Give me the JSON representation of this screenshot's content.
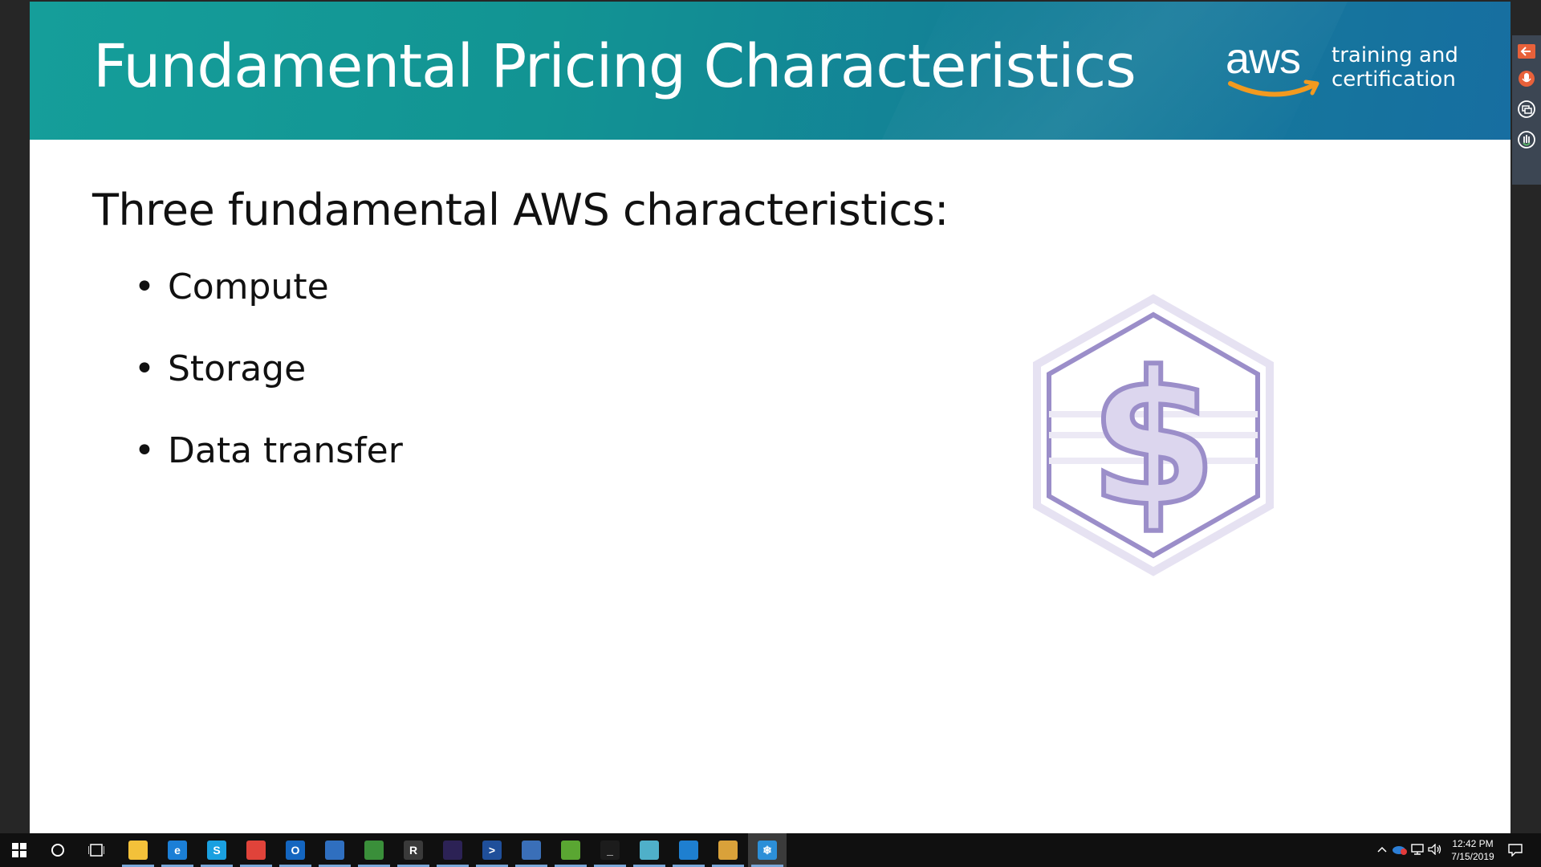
{
  "slide": {
    "title": "Fundamental Pricing Characteristics",
    "logo": {
      "wordmark": "aws",
      "tagline_line1": "training and",
      "tagline_line2": "certification"
    },
    "subtitle": "Three fundamental AWS characteristics:",
    "bullets": [
      {
        "bullet": "•",
        "text": "Compute"
      },
      {
        "bullet": "•",
        "text": "Storage"
      },
      {
        "bullet": "•",
        "text": "Data transfer"
      }
    ],
    "graphic": {
      "icon": "hexagon-dollar-icon",
      "color": "#9b8ec9"
    }
  },
  "side_toolbar": {
    "buttons": [
      {
        "name": "back-arrow-icon",
        "color": "#e8613a"
      },
      {
        "name": "microphone-icon",
        "color": "#e8613a"
      },
      {
        "name": "screen-share-icon",
        "color": "#ffffff"
      },
      {
        "name": "raise-hand-icon",
        "color": "#ffffff"
      }
    ]
  },
  "taskbar": {
    "start_icon": "windows-start-icon",
    "search_icon": "cortana-circle-icon",
    "taskview_icon": "task-view-icon",
    "apps": [
      {
        "name": "file-explorer-icon",
        "glyph": "",
        "color": "#f3c13a"
      },
      {
        "name": "edge-icon",
        "glyph": "e",
        "color": "#1b7fd6"
      },
      {
        "name": "skype-business-icon",
        "glyph": "S",
        "color": "#1aa0e0"
      },
      {
        "name": "chrome-icon",
        "glyph": "",
        "color": "#e0433a"
      },
      {
        "name": "outlook-icon",
        "glyph": "O",
        "color": "#1466c0"
      },
      {
        "name": "network-icon",
        "glyph": "",
        "color": "#2f6fc0"
      },
      {
        "name": "security-icon",
        "glyph": "",
        "color": "#3a8f3a"
      },
      {
        "name": "r-console-icon",
        "glyph": "R",
        "color": "#3a3a3a"
      },
      {
        "name": "eclipse-icon",
        "glyph": "",
        "color": "#2c2255"
      },
      {
        "name": "powershell-icon",
        "glyph": ">",
        "color": "#1f4f9a"
      },
      {
        "name": "remote-desktop-icon",
        "glyph": "",
        "color": "#3a6fb8"
      },
      {
        "name": "notepad-icon",
        "glyph": "",
        "color": "#5aa632"
      },
      {
        "name": "terminal-icon",
        "glyph": "_",
        "color": "#1c1c1c"
      },
      {
        "name": "pen-tool-icon",
        "glyph": "",
        "color": "#4fb0c9"
      },
      {
        "name": "vscode-icon",
        "glyph": "",
        "color": "#1e7fd0"
      },
      {
        "name": "paint-icon",
        "glyph": "",
        "color": "#d9a13a"
      },
      {
        "name": "snowflake-app-icon",
        "glyph": "❄",
        "color": "#2c8fd8"
      }
    ],
    "tray": {
      "chevron_icon": "chevron-up-icon",
      "onedrive_icon": "onedrive-error-icon",
      "network_icon": "network-tray-icon",
      "volume_icon": "volume-icon",
      "notification_icon": "notification-center-icon"
    },
    "clock": {
      "time": "12:42 PM",
      "date": "7/15/2019"
    }
  }
}
